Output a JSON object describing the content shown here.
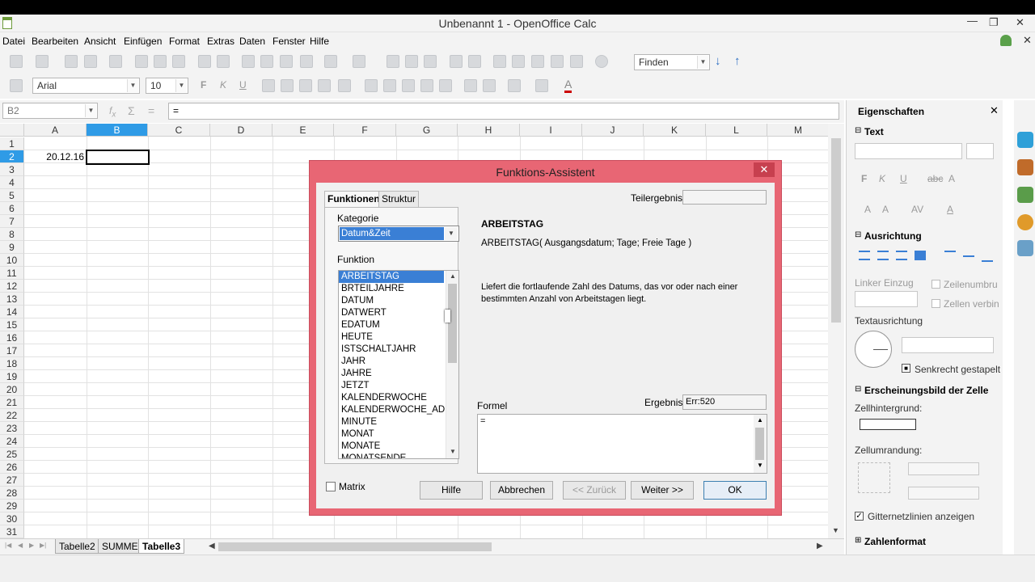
{
  "window": {
    "title": "Unbenannt 1 - OpenOffice Calc"
  },
  "menu": [
    "Datei",
    "Bearbeiten",
    "Ansicht",
    "Einfügen",
    "Format",
    "Extras",
    "Daten",
    "Fenster",
    "Hilfe"
  ],
  "toolbar": {
    "find_placeholder": "Finden"
  },
  "format_toolbar": {
    "font_name": "Arial",
    "font_size": "10"
  },
  "formula_bar": {
    "name_box": "B2",
    "content": "="
  },
  "grid": {
    "columns": [
      "A",
      "B",
      "C",
      "D",
      "E",
      "F",
      "G",
      "H",
      "I",
      "J",
      "K",
      "L",
      "M"
    ],
    "active_column": "B",
    "active_row": "2",
    "rows": [
      "1",
      "2",
      "3",
      "4",
      "5",
      "6",
      "7",
      "8",
      "9",
      "10",
      "11",
      "12",
      "13",
      "14",
      "15",
      "16",
      "17",
      "18",
      "19",
      "20",
      "21",
      "22",
      "23",
      "24",
      "25",
      "26",
      "27",
      "28",
      "29",
      "30",
      "31"
    ],
    "cell_a2": "20.12.16"
  },
  "sheet_tabs": [
    "Tabelle2",
    "SUMME",
    "Tabelle3"
  ],
  "active_sheet": "Tabelle3",
  "sidebar": {
    "title": "Eigenschaften",
    "sections": {
      "text": "Text",
      "alignment": "Ausrichtung",
      "cell_appearance": "Erscheinungsbild der Zelle",
      "number_format": "Zahlenformat"
    },
    "left_indent": "Linker Einzug",
    "wrap_text": "Zeilenumbru",
    "merge_cells": "Zellen verbin",
    "text_orientation": "Textausrichtung",
    "vertically_stacked": "Senkrecht gestapelt",
    "cell_background": "Zellhintergrund:",
    "cell_border": "Zellumrandung:",
    "gridlines": "Gitternetzlinien anzeigen"
  },
  "dialog": {
    "title": "Funktions-Assistent",
    "tabs": [
      "Funktionen",
      "Struktur"
    ],
    "category_label": "Kategorie",
    "category_value": "Datum&Zeit",
    "function_label": "Funktion",
    "functions": [
      "ARBEITSTAG",
      "BRTEILJAHRE",
      "DATUM",
      "DATWERT",
      "EDATUM",
      "HEUTE",
      "ISTSCHALTJAHR",
      "JAHR",
      "JAHRE",
      "JETZT",
      "KALENDERWOCHE",
      "KALENDERWOCHE_ADD",
      "MINUTE",
      "MONAT",
      "MONATE",
      "MONATSENDE"
    ],
    "selected_function": "ARBEITSTAG",
    "subtotal_label": "Teilergebnis",
    "func_name": "ARBEITSTAG",
    "func_signature": "ARBEITSTAG( Ausgangsdatum; Tage; Freie Tage )",
    "func_description": "Liefert die fortlaufende Zahl des Datums, das vor oder nach einer bestimmten Anzahl von Arbeitstagen liegt.",
    "formula_label": "Formel",
    "formula_value": "=",
    "result_label": "Ergebnis",
    "result_value": "Err:520",
    "matrix_label": "Matrix",
    "buttons": {
      "help": "Hilfe",
      "cancel": "Abbrechen",
      "back": "<< Zurück",
      "next": "Weiter >>",
      "ok": "OK"
    }
  },
  "colors": {
    "accent": "#2f9be6",
    "dialog_frame": "#e86674",
    "selection": "#3a7fd5"
  }
}
